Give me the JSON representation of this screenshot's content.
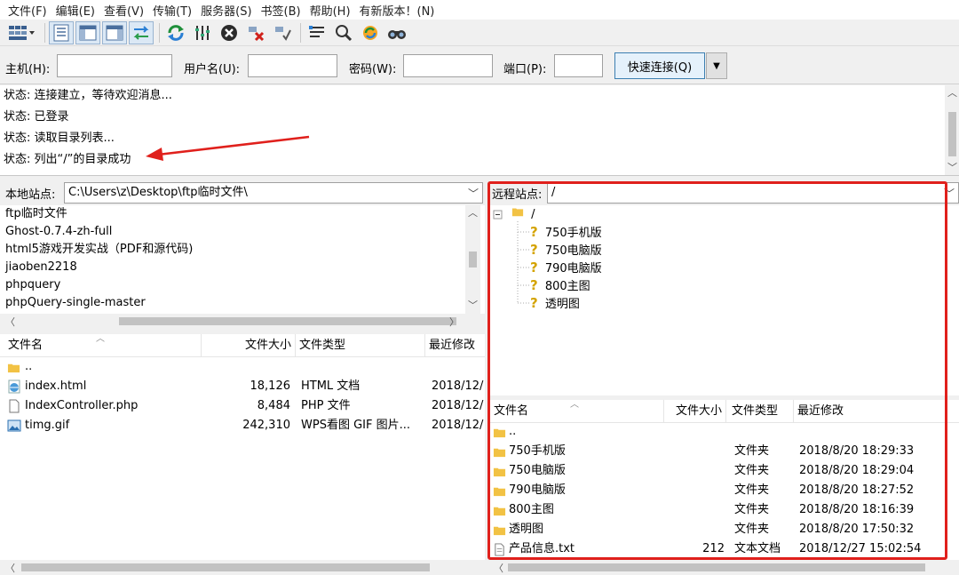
{
  "menu": [
    "文件(F)",
    "编辑(E)",
    "查看(V)",
    "传输(T)",
    "服务器(S)",
    "书签(B)",
    "帮助(H)",
    "有新版本！(N)"
  ],
  "toolbar": {
    "icons": [
      "site-manager-icon",
      "toggle-log-icon",
      "toggle-local-tree-icon",
      "toggle-remote-tree-icon",
      "transfer-queue-icon",
      "refresh-icon",
      "process-queue-icon",
      "cancel-icon",
      "disconnect-icon",
      "reconnect-icon",
      "filter-icon",
      "compare-icon",
      "sync-browse-icon",
      "search-icon"
    ]
  },
  "quickconnect": {
    "host_label": "主机(H):",
    "user_label": "用户名(U):",
    "pass_label": "密码(W):",
    "port_label": "端口(P):",
    "host_value": "",
    "user_value": "",
    "pass_value": "",
    "port_value": "",
    "button": "快速连接(Q)"
  },
  "log": [
    {
      "prefix": "状态:",
      "text": "连接建立，等待欢迎消息..."
    },
    {
      "prefix": "状态:",
      "text": "已登录"
    },
    {
      "prefix": "状态:",
      "text": "读取目录列表..."
    },
    {
      "prefix": "状态:",
      "text": "列出“/”的目录成功"
    }
  ],
  "local": {
    "site_label": "本地站点:",
    "path": "C:\\Users\\z\\Desktop\\ftp临时文件\\",
    "tree": [
      "ftp临时文件",
      "Ghost-0.7.4-zh-full",
      "html5游戏开发实战（PDF和源代码)",
      "jiaoben2218",
      "phpquery",
      "phpQuery-single-master"
    ],
    "columns": {
      "name": "文件名",
      "size": "文件大小",
      "type": "文件类型",
      "modified": "最近修改"
    },
    "files": [
      {
        "name": "..",
        "size": "",
        "type": "",
        "modified": "",
        "icon": "folder-icon"
      },
      {
        "name": "index.html",
        "size": "18,126",
        "type": "HTML 文档",
        "modified": "2018/12/",
        "icon": "html-file-icon"
      },
      {
        "name": "IndexController.php",
        "size": "8,484",
        "type": "PHP 文件",
        "modified": "2018/12/",
        "icon": "file-icon"
      },
      {
        "name": "timg.gif",
        "size": "242,310",
        "type": "WPS看图 GIF 图片...",
        "modified": "2018/12/",
        "icon": "image-file-icon"
      }
    ]
  },
  "remote": {
    "site_label": "远程站点:",
    "path": "/",
    "tree_root": "/",
    "tree": [
      "750手机版",
      "750电脑版",
      "790电脑版",
      "800主图",
      "透明图"
    ],
    "columns": {
      "name": "文件名",
      "size": "文件大小",
      "type": "文件类型",
      "modified": "最近修改"
    },
    "files": [
      {
        "name": "..",
        "size": "",
        "type": "",
        "modified": "",
        "icon": "folder-icon"
      },
      {
        "name": "750手机版",
        "size": "",
        "type": "文件夹",
        "modified": "2018/8/20 18:29:33",
        "icon": "folder-icon"
      },
      {
        "name": "750电脑版",
        "size": "",
        "type": "文件夹",
        "modified": "2018/8/20 18:29:04",
        "icon": "folder-icon"
      },
      {
        "name": "790电脑版",
        "size": "",
        "type": "文件夹",
        "modified": "2018/8/20 18:27:52",
        "icon": "folder-icon"
      },
      {
        "name": "800主图",
        "size": "",
        "type": "文件夹",
        "modified": "2018/8/20 18:16:39",
        "icon": "folder-icon"
      },
      {
        "name": "透明图",
        "size": "",
        "type": "文件夹",
        "modified": "2018/8/20 17:50:32",
        "icon": "folder-icon"
      },
      {
        "name": "产品信息.txt",
        "size": "212",
        "type": "文本文档",
        "modified": "2018/12/27 15:02:54",
        "icon": "text-file-icon"
      }
    ]
  },
  "colors": {
    "annotation": "#e0201c",
    "folder": "#f2c244",
    "accent": "#3c7fb1"
  }
}
